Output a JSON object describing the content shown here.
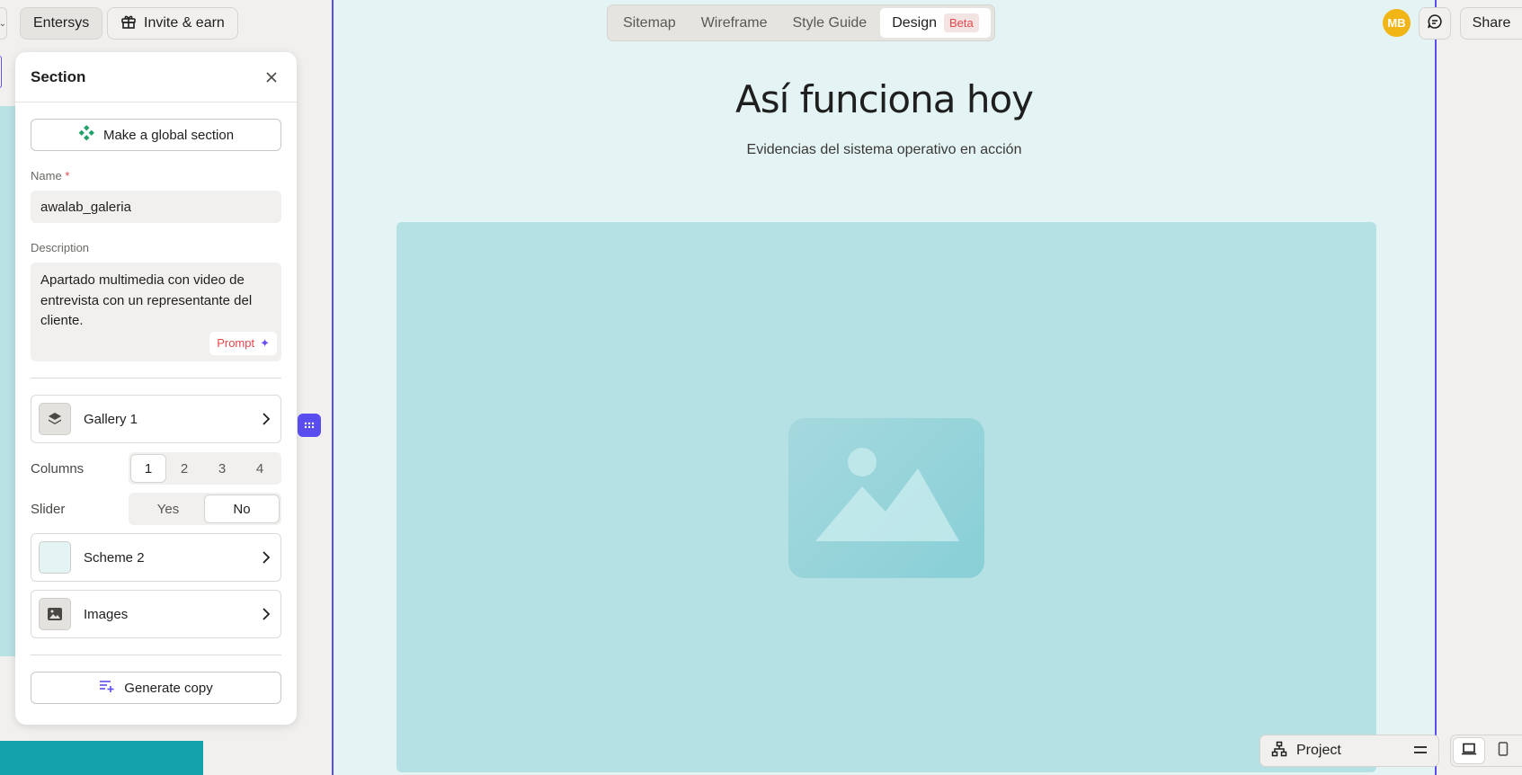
{
  "topbar": {
    "workspace_label": "Entersys",
    "invite_label": "Invite & earn",
    "tabs": [
      {
        "label": "Sitemap"
      },
      {
        "label": "Wireframe"
      },
      {
        "label": "Style Guide"
      },
      {
        "label": "Design",
        "badge": "Beta",
        "active": true
      }
    ],
    "avatar_initials": "MB",
    "share_label": "Share"
  },
  "panel": {
    "title": "Section",
    "global_button": "Make a global section",
    "name_label": "Name",
    "name_required": "*",
    "name_value": "awalab_galeria",
    "description_label": "Description",
    "description_value": "Apartado multimedia con video de entrevista con un representante del cliente.",
    "prompt_label": "Prompt",
    "component": {
      "label": "Gallery 1"
    },
    "columns": {
      "label": "Columns",
      "options": [
        "1",
        "2",
        "3",
        "4"
      ],
      "selected": "1"
    },
    "slider": {
      "label": "Slider",
      "options": [
        "Yes",
        "No"
      ],
      "selected": "No"
    },
    "scheme": {
      "label": "Scheme 2",
      "swatch_color": "#e4f4f4"
    },
    "images": {
      "label": "Images"
    },
    "generate_label": "Generate copy"
  },
  "canvas": {
    "title": "Así funciona hoy",
    "subtitle": "Evidencias del sistema operativo en acción"
  },
  "bottom": {
    "project_label": "Project"
  },
  "colors": {
    "accent": "#5a4df0",
    "canvas_bg": "#e4f4f4",
    "media_bg": "#b6e1e4",
    "avatar": "#f2b516",
    "required": "#e5484d"
  }
}
